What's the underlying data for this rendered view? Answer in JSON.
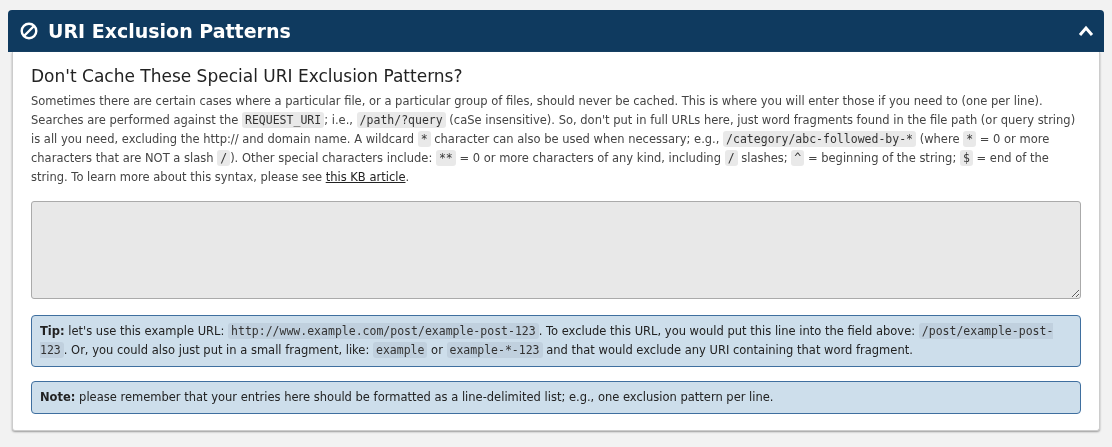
{
  "panel": {
    "title": "URI Exclusion Patterns",
    "expanded": true
  },
  "section": {
    "heading": "Don't Cache These Special URI Exclusion Patterns?",
    "description": [
      {
        "kind": "text",
        "text": "Sometimes there are certain cases where a particular file, or a particular group of files, should never be cached. This is where you will enter those if you need to (one per line). Searches are performed against the "
      },
      {
        "kind": "code",
        "text": "REQUEST_URI"
      },
      {
        "kind": "text",
        "text": "; i.e., "
      },
      {
        "kind": "code",
        "text": "/path/?query"
      },
      {
        "kind": "text",
        "text": " (caSe insensitive). So, don't put in full URLs here, just word fragments found in the file path (or query string) is all you need, excluding the http:// and domain name. A wildcard "
      },
      {
        "kind": "code",
        "text": "*"
      },
      {
        "kind": "text",
        "text": " character can also be used when necessary; e.g., "
      },
      {
        "kind": "code",
        "text": "/category/abc-followed-by-*"
      },
      {
        "kind": "text",
        "text": " (where "
      },
      {
        "kind": "code",
        "text": "*"
      },
      {
        "kind": "text",
        "text": " = 0 or more characters that are NOT a slash "
      },
      {
        "kind": "code",
        "text": "/"
      },
      {
        "kind": "text",
        "text": "). Other special characters include: "
      },
      {
        "kind": "code",
        "text": "**"
      },
      {
        "kind": "text",
        "text": " = 0 or more characters of any kind, including "
      },
      {
        "kind": "code",
        "text": "/"
      },
      {
        "kind": "text",
        "text": " slashes; "
      },
      {
        "kind": "code",
        "text": "^"
      },
      {
        "kind": "text",
        "text": " = beginning of the string; "
      },
      {
        "kind": "code",
        "text": "$"
      },
      {
        "kind": "text",
        "text": " = end of the string. To learn more about this syntax, please see "
      },
      {
        "kind": "link",
        "text": "this KB article"
      },
      {
        "kind": "text",
        "text": "."
      }
    ],
    "notes": [
      {
        "parts": [
          {
            "kind": "bold",
            "text": "Tip:"
          },
          {
            "kind": "text",
            "text": " let's use this example URL: "
          },
          {
            "kind": "code",
            "text": "http://www.example.com/post/example-post-123"
          },
          {
            "kind": "text",
            "text": ". To exclude this URL, you would put this line into the field above: "
          },
          {
            "kind": "code",
            "text": "/post/example-post-123"
          },
          {
            "kind": "text",
            "text": ". Or, you could also just put in a small fragment, like: "
          },
          {
            "kind": "code",
            "text": "example"
          },
          {
            "kind": "text",
            "text": " or "
          },
          {
            "kind": "code",
            "text": "example-*-123"
          },
          {
            "kind": "text",
            "text": " and that would exclude any URI containing that word fragment."
          }
        ]
      },
      {
        "parts": [
          {
            "kind": "bold",
            "text": "Note:"
          },
          {
            "kind": "text",
            "text": " please remember that your entries here should be formatted as a line-delimited list; e.g., one exclusion pattern per line."
          }
        ]
      }
    ]
  }
}
